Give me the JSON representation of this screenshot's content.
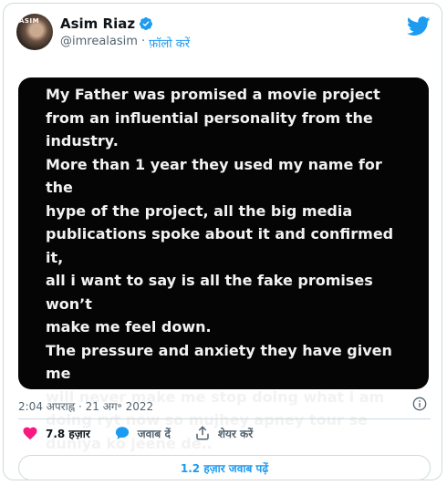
{
  "author": {
    "display_name": "Asim Riaz",
    "handle": "@imrealasim",
    "separator": "·",
    "follow_label": "फ़ॉलो करें",
    "avatar_text": "ASIM"
  },
  "tweet": {
    "image_text": "My Father was promised a movie project\nfrom an influential personality from the\nindustry.\nMore than 1 year they used my name for the\nhype of the project, all the big media\npublications spoke about it and confirmed it,\nall i want to say is all the fake promises won’t\nmake me feel down.\nThe pressure and anxiety they have given me\nwill never make me stop doing what i am\ndoing ryt now so mujhey apney tour se\nduniya ko jeene de..",
    "timestamp": "2:04 अपराह्न · 21 अग॰ 2022"
  },
  "actions": {
    "likes": "7.8 हज़ार",
    "reply_label": "जवाब दें",
    "share_label": "शेयर करें"
  },
  "replies_button": "1.2 हज़ार जवाब पढ़ें",
  "colors": {
    "accent": "#1d9bf0",
    "like": "#f91880",
    "muted": "#536471",
    "border": "#cfd9de"
  },
  "icons": [
    "verified-badge-icon",
    "twitter-bird-icon",
    "info-icon",
    "heart-icon",
    "reply-icon",
    "share-icon"
  ]
}
